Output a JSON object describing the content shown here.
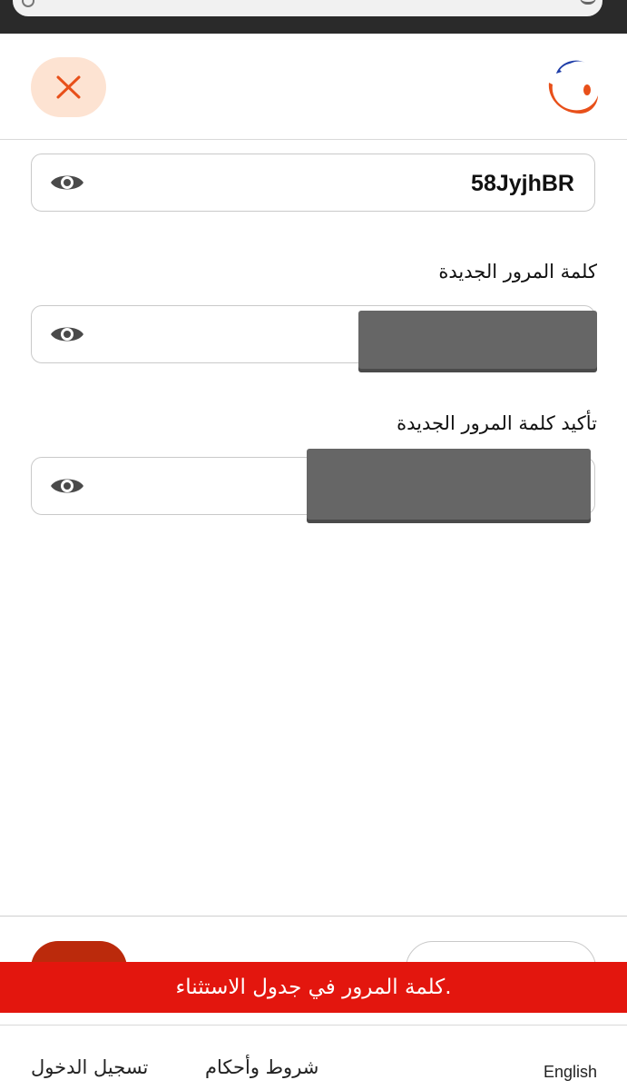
{
  "header": {
    "close_icon": "close-icon",
    "logo_icon": "brand-logo-icon",
    "accent_color": "#e8501a",
    "close_bg_color": "#fde3d2"
  },
  "form": {
    "current_password": {
      "value": "58JyjhBR",
      "visibility_icon": "eye-icon"
    },
    "new_password": {
      "label": "كلمة المرور الجديدة",
      "visibility_icon": "eye-icon"
    },
    "confirm_password": {
      "label": "تأكيد كلمة المرور الجديدة",
      "visibility_icon": "eye-icon"
    }
  },
  "toast": {
    "message": ".كلمة المرور في جدول الاستثناء",
    "color": "#e3160e"
  },
  "footer": {
    "language_link": "English",
    "terms_link": "شروط وأحكام",
    "register_link": "تسجيل الدخول"
  }
}
